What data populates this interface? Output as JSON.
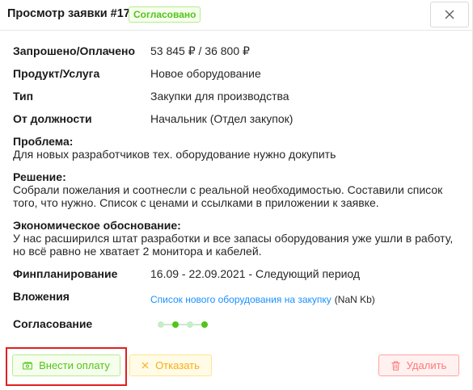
{
  "header": {
    "title": "Просмотр заявки #17",
    "status_badge": "Согласовано",
    "close_icon": "close-icon"
  },
  "fields": {
    "requested_paid": {
      "label": "Запрошено/Оплачено",
      "value": "53 845 ₽ / 36 800 ₽"
    },
    "product": {
      "label": "Продукт/Услуга",
      "value": "Новое оборудование"
    },
    "type": {
      "label": "Тип",
      "value": "Закупки для производства"
    },
    "position": {
      "label": "От должности",
      "value": "Начальник (Отдел закупок)"
    },
    "problem": {
      "label": "Проблема:",
      "value": "Для новых разработчиков тех. оборудование нужно докупить"
    },
    "solution": {
      "label": "Решение:",
      "value": "Собрали пожелания и соотнесли с реальной необходимостью. Составили список того, что нужно. Список с ценами и ссылками в приложении к заявке."
    },
    "justification": {
      "label": "Экономическое обоснование:",
      "value": "У нас расширился штат разработки и все запасы оборудования уже ушли в работу, но всё равно не хватает 2 монитора и кабелей."
    },
    "planning": {
      "label": "Финпланирование",
      "value": "16.09 - 22.09.2021 - Следующий период"
    },
    "attachments": {
      "label": "Вложения",
      "link": "Список нового оборудования на закупку",
      "size": "(NaN Kb)"
    },
    "approval": {
      "label": "Согласование",
      "steps_total": 4,
      "steps_highlighted": [
        1,
        3
      ]
    }
  },
  "actions": {
    "pay": "Внести оплату",
    "reject": "Отказать",
    "delete": "Удалить"
  },
  "colors": {
    "success": "#52c41a",
    "warning": "#faad14",
    "danger": "#ff7875",
    "link": "#1890ff",
    "highlight_frame": "#e0201f"
  }
}
